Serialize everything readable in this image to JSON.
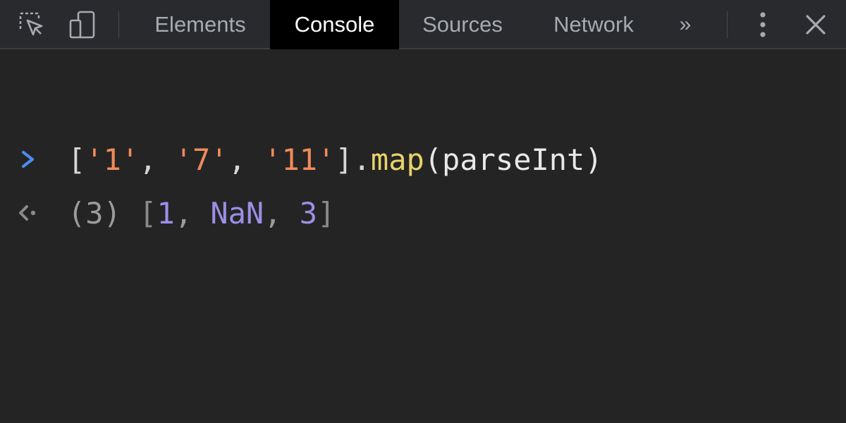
{
  "toolbar": {
    "icons": {
      "inspect": "inspect-element-icon",
      "device": "device-toolbar-icon",
      "overflow": "more-tabs-icon",
      "menu": "kebab-menu-icon",
      "close": "close-icon"
    },
    "tabs": [
      {
        "label": "Elements",
        "active": false
      },
      {
        "label": "Console",
        "active": true
      },
      {
        "label": "Sources",
        "active": false
      },
      {
        "label": "Network",
        "active": false
      }
    ],
    "overflow_label": "»"
  },
  "console": {
    "input": {
      "open_bracket": "[",
      "str1": "'1'",
      "comma1": ", ",
      "str2": "'7'",
      "comma2": ", ",
      "str3": "'11'",
      "close_bracket_dot": "].",
      "method": "map",
      "args": "(parseInt)"
    },
    "output": {
      "count": "(3) ",
      "open_bracket": "[",
      "v1": "1",
      "sep1": ", ",
      "v2": "NaN",
      "sep2": ", ",
      "v3": "3",
      "close_bracket": "]"
    }
  },
  "colors": {
    "background": "#242424",
    "toolbar": "#292a2d",
    "active_tab": "#000000",
    "prompt": "#4d8cf0",
    "string": "#ef8a5a",
    "function": "#e6d36a",
    "number": "#9b8fe6"
  }
}
